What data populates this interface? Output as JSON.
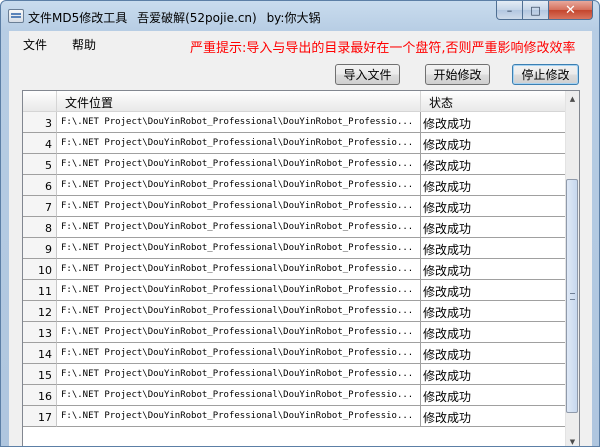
{
  "window": {
    "title_parts": [
      "文件MD5修改工具",
      "吾爱破解(52pojie.cn)",
      "by:你大锅"
    ],
    "buttons": {
      "minimize": "–",
      "maximize": "□",
      "close": "✕"
    }
  },
  "menu": [
    {
      "label": "文件"
    },
    {
      "label": "帮助"
    }
  ],
  "warning": "严重提示:导入与导出的目录最好在一个盘符,否则严重影响修改效率",
  "toolbar": {
    "import_label": "导入文件",
    "start_label": "开始修改",
    "stop_label": "停止修改"
  },
  "table": {
    "columns": [
      "",
      "文件位置",
      "状态"
    ],
    "rows": [
      {
        "index": "3",
        "path": "F:\\.NET Project\\DouYinRobot_Professional\\DouYinRobot_Professio...",
        "status": "修改成功"
      },
      {
        "index": "4",
        "path": "F:\\.NET Project\\DouYinRobot_Professional\\DouYinRobot_Professio...",
        "status": "修改成功"
      },
      {
        "index": "5",
        "path": "F:\\.NET Project\\DouYinRobot_Professional\\DouYinRobot_Professio...",
        "status": "修改成功"
      },
      {
        "index": "6",
        "path": "F:\\.NET Project\\DouYinRobot_Professional\\DouYinRobot_Professio...",
        "status": "修改成功"
      },
      {
        "index": "7",
        "path": "F:\\.NET Project\\DouYinRobot_Professional\\DouYinRobot_Professio...",
        "status": "修改成功"
      },
      {
        "index": "8",
        "path": "F:\\.NET Project\\DouYinRobot_Professional\\DouYinRobot_Professio...",
        "status": "修改成功"
      },
      {
        "index": "9",
        "path": "F:\\.NET Project\\DouYinRobot_Professional\\DouYinRobot_Professio...",
        "status": "修改成功"
      },
      {
        "index": "10",
        "path": "F:\\.NET Project\\DouYinRobot_Professional\\DouYinRobot_Professio...",
        "status": "修改成功"
      },
      {
        "index": "11",
        "path": "F:\\.NET Project\\DouYinRobot_Professional\\DouYinRobot_Professio...",
        "status": "修改成功"
      },
      {
        "index": "12",
        "path": "F:\\.NET Project\\DouYinRobot_Professional\\DouYinRobot_Professio...",
        "status": "修改成功"
      },
      {
        "index": "13",
        "path": "F:\\.NET Project\\DouYinRobot_Professional\\DouYinRobot_Professio...",
        "status": "修改成功"
      },
      {
        "index": "14",
        "path": "F:\\.NET Project\\DouYinRobot_Professional\\DouYinRobot_Professio...",
        "status": "修改成功"
      },
      {
        "index": "15",
        "path": "F:\\.NET Project\\DouYinRobot_Professional\\DouYinRobot_Professio...",
        "status": "修改成功"
      },
      {
        "index": "16",
        "path": "F:\\.NET Project\\DouYinRobot_Professional\\DouYinRobot_Professio...",
        "status": "修改成功"
      },
      {
        "index": "17",
        "path": "F:\\.NET Project\\DouYinRobot_Professional\\DouYinRobot_Professio...",
        "status": "修改成功"
      }
    ]
  },
  "colors": {
    "warning": "#ff0000",
    "focus_border": "#3c7fb1"
  },
  "icons": {
    "app": "app-window-icon",
    "scroll_up": "scroll-up-arrow-icon",
    "scroll_down": "scroll-down-arrow-icon"
  }
}
